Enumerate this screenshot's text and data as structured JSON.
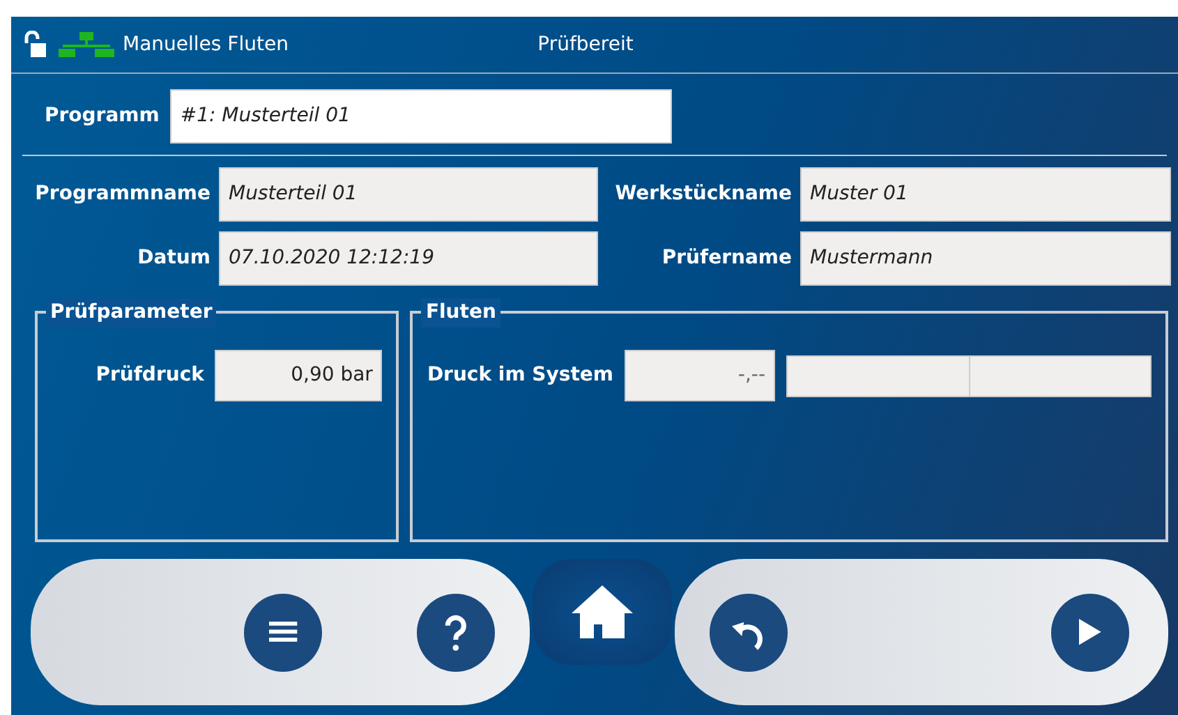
{
  "header": {
    "mode": "Manuelles Fluten",
    "status": "Prüfbereit"
  },
  "program": {
    "label": "Programm",
    "value": "#1: Musterteil 01"
  },
  "fields": [
    {
      "label": "Programmname",
      "value": "Musterteil 01"
    },
    {
      "label": "Werkstückname",
      "value": "Muster 01"
    },
    {
      "label": "Datum",
      "value": "07.10.2020 12:12:19"
    },
    {
      "label": "Prüfername",
      "value": "Mustermann"
    }
  ],
  "test_parameters": {
    "title": "Prüfparameter",
    "label": "Prüfdruck",
    "value": "0,90 bar"
  },
  "flooding": {
    "title": "Fluten",
    "label": "Druck im System",
    "value": "-,--"
  },
  "toolbar": [
    {
      "kind": "menu",
      "selected": false
    },
    {
      "kind": "help",
      "selected": false
    },
    {
      "kind": "home",
      "selected": true
    },
    {
      "kind": "undo",
      "selected": false
    },
    {
      "kind": "play",
      "selected": false
    }
  ]
}
